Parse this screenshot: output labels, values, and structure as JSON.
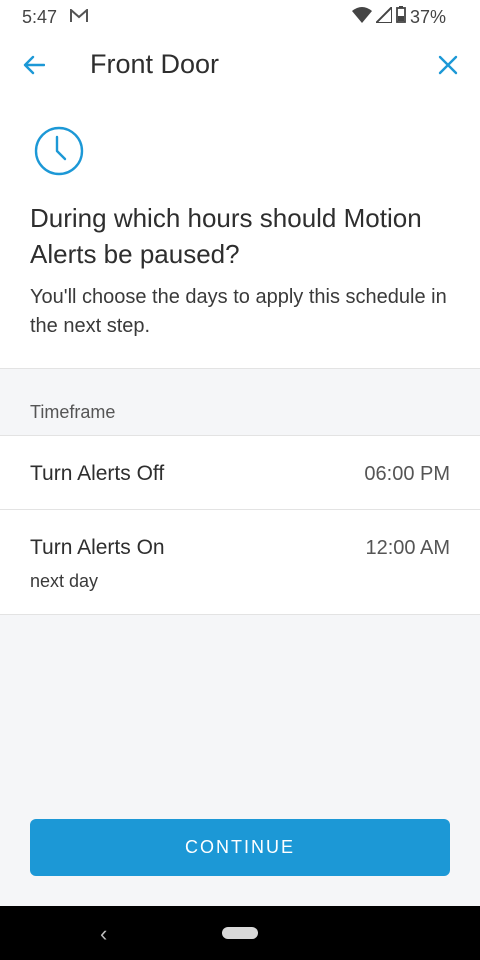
{
  "status_bar": {
    "time": "5:47",
    "battery": "37%"
  },
  "header": {
    "title": "Front Door"
  },
  "prompt": {
    "question": "During which hours should Motion Alerts be paused?",
    "description": "You'll choose the days to apply this schedule in the next step."
  },
  "timeframe": {
    "section_label": "Timeframe",
    "rows": [
      {
        "label": "Turn Alerts Off",
        "value": "06:00 PM"
      },
      {
        "label": "Turn Alerts On",
        "value": "12:00 AM",
        "sub": "next day"
      }
    ]
  },
  "continue_label": "CONTINUE",
  "colors": {
    "accent": "#1c98d6",
    "background_gray": "#f5f6f8"
  },
  "icons": [
    "back-arrow-icon",
    "close-icon",
    "clock-icon",
    "mail-icon",
    "wifi-icon",
    "signal-icon",
    "battery-icon"
  ]
}
